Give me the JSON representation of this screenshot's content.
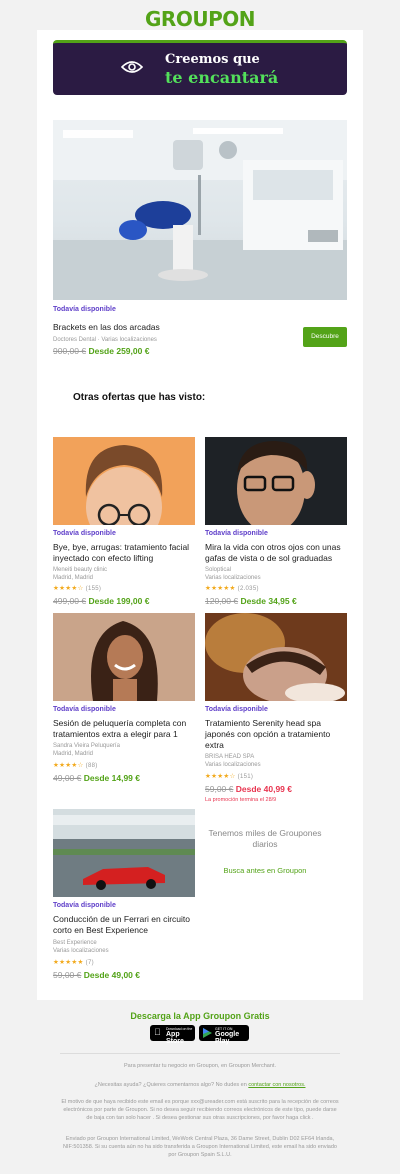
{
  "brand": {
    "logo": "GROUPON"
  },
  "banner": {
    "line1": "Creemos que",
    "line2": "te encantará",
    "icon": "eye-icon"
  },
  "hero": {
    "image": "dental-clinic-photo",
    "available": "Todavía disponible",
    "title": "Brackets en las dos arcadas",
    "merchant": "Doctores Dental · Varias localizaciones",
    "old_price": "900,00 €",
    "new_price": "Desde 259,00 €",
    "button": "Descubre"
  },
  "section_title": "Otras ofertas que has visto:",
  "deals": [
    {
      "image": "woman-glasses-photo",
      "available": "Todavía disponible",
      "title": "Bye, bye, arrugas: tratamiento facial inyectado con efecto lifting",
      "meta": [
        "Meneiti beauty clinic",
        "Madrid, Madrid"
      ],
      "stars": "★★★★☆",
      "rating_count": "(155)",
      "old_price": "499,00 €",
      "new_price": "Desde 199,00 €"
    },
    {
      "image": "man-glasses-photo",
      "available": "Todavía disponible",
      "title": "Mira la vida con otros ojos con unas gafas de vista o de sol graduadas",
      "meta": [
        "Soloptical",
        "Varias localizaciones"
      ],
      "stars": "★★★★★",
      "rating_count": "(2.035)",
      "old_price": "120,00 €",
      "new_price": "Desde 34,95 €"
    },
    {
      "image": "curly-hair-woman-photo",
      "available": "Todavía disponible",
      "title": "Sesión de peluquería completa con tratamientos extra a elegir para 1",
      "meta": [
        "Sandra Vieira Peluquería",
        "Madrid, Madrid"
      ],
      "stars": "★★★★☆",
      "rating_count": "(88)",
      "old_price": "49,00 €",
      "new_price": "Desde 14,99 €"
    },
    {
      "image": "head-spa-photo",
      "available": "Todavía disponible",
      "title": "Tratamiento Serenity head spa japonés con opción a tratamiento extra",
      "meta": [
        "BRISA HEAD SPA",
        "Varias localizaciones"
      ],
      "stars": "★★★★☆",
      "rating_count": "(151)",
      "old_price": "59,00 €",
      "new_price": "Desde 40,99 €",
      "promo": "La promoción termina el 28/9"
    },
    {
      "image": "ferrari-track-photo",
      "available": "Todavía disponible",
      "title": "Conducción de un Ferrari en circuito corto en Best Experience",
      "meta": [
        "Best Experience",
        "Varias localizaciones"
      ],
      "stars": "★★★★★",
      "rating_count": "(7)",
      "old_price": "59,00 €",
      "new_price": "Desde 49,00 €"
    }
  ],
  "promo_box": {
    "text": "Tenemos miles de Groupones diarios",
    "link": "Busca antes en Groupon"
  },
  "app": {
    "title": "Descarga la App Groupon Gratis",
    "appstore_small": "Download on the",
    "appstore_big": "App Store",
    "gplay_small": "GET IT ON",
    "gplay_big": "Google Play"
  },
  "footer": {
    "merchant": "Para presentar tu negocio en Groupon, en Groupon Merchant.",
    "help": "¿Necesitas ayuda? ¿Quieres comentarnos algo? No dudes en",
    "help_link": "contactar con nosotros.",
    "legal": "El motivo de que haya recibido este email es porque xxx@ureader.com está suscrito para la recepción de correos electrónicos por parte de Groupon. Si no desea seguir recibiendo correos electrónicos de este tipo, puede darse de baja con tan solo hacer . Si desea gestionar sus otras suscripciones, por favor haga click .",
    "sender": "Enviado por Groupon International Limited, WeWork Central Plaza, 36 Dame Street, Dublin D02 EF64 Irlanda, NIF:501358. Si su cuenta aún no ha sido transferida a Groupon International Limited, este email ha sido enviado por Groupon Spain S.L.U."
  }
}
